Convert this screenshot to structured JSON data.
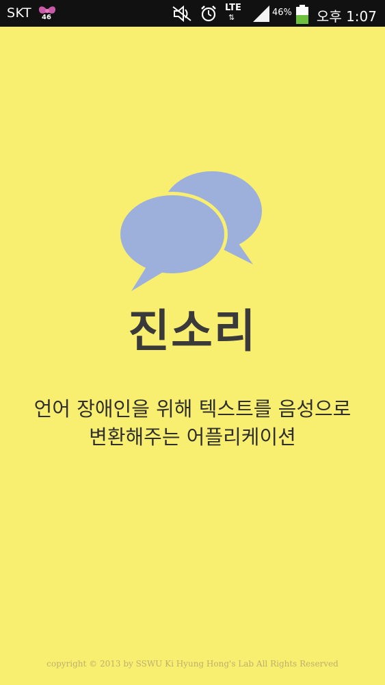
{
  "status_bar": {
    "carrier": "SKT",
    "notification_badge": "46",
    "network": "LTE",
    "network_arrows": "⇅",
    "battery_percent": "46%",
    "time": "오후 1:07"
  },
  "app": {
    "title": "진소리",
    "tagline_line1": "언어 장애인을 위해 텍스트를 음성으로",
    "tagline_line2": "변환해주는 어플리케이션",
    "copyright": "copyright © 2013 by SSWU Ki Hyung Hong's Lab All Rights Reserved"
  },
  "colors": {
    "background": "#f8ee6f",
    "bubble_front": "#9db0dc",
    "bubble_back": "#9db0dc",
    "title": "#3a3a3a",
    "status_bar": "#111111"
  },
  "icons": {
    "logo": "chat-bubbles-icon",
    "bow": "bow-icon",
    "mute": "mute-icon",
    "alarm": "alarm-icon",
    "signal": "signal-icon",
    "battery": "battery-icon"
  }
}
